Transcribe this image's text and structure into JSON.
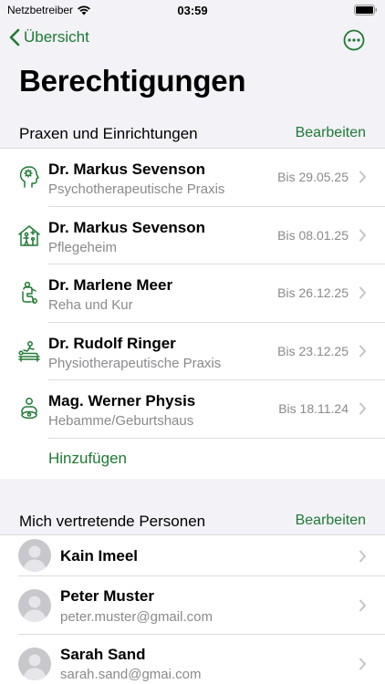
{
  "status_bar": {
    "carrier": "Netzbetreiber",
    "time": "03:59"
  },
  "nav": {
    "back_label": "Übersicht"
  },
  "page": {
    "title": "Berechtigungen"
  },
  "practices": {
    "header": "Praxen und Einrichtungen",
    "edit_label": "Bearbeiten",
    "items": [
      {
        "name": "Dr. Markus Sevenson",
        "type": "Psychotherapeutische Praxis",
        "date": "Bis 29.05.25",
        "icon": "psychotherapy-head-icon"
      },
      {
        "name": "Dr. Markus Sevenson",
        "type": "Pflegeheim",
        "date": "Bis 08.01.25",
        "icon": "care-home-icon"
      },
      {
        "name": "Dr. Marlene Meer",
        "type": "Reha und Kur",
        "date": "Bis 26.12.25",
        "icon": "rehab-person-icon"
      },
      {
        "name": "Dr. Rudolf Ringer",
        "type": "Physiotherapeutische Praxis",
        "date": "Bis 23.12.25",
        "icon": "physio-massage-icon"
      },
      {
        "name": "Mag. Werner Physis",
        "type": "Hebamme/Geburtshaus",
        "date": "Bis 18.11.24",
        "icon": "midwife-icon"
      }
    ],
    "add_label": "Hinzufügen"
  },
  "representatives": {
    "header": "Mich vertretende Personen",
    "edit_label": "Bearbeiten",
    "items": [
      {
        "name": "Kain Imeel",
        "email": ""
      },
      {
        "name": "Peter Muster",
        "email": "peter.muster@gmail.com"
      },
      {
        "name": "Sarah Sand",
        "email": "sarah.sand@gmai.com"
      }
    ]
  },
  "colors": {
    "accent": "#1f7a34",
    "background": "#f2f2f7",
    "secondary_text": "#8a8a8e"
  }
}
